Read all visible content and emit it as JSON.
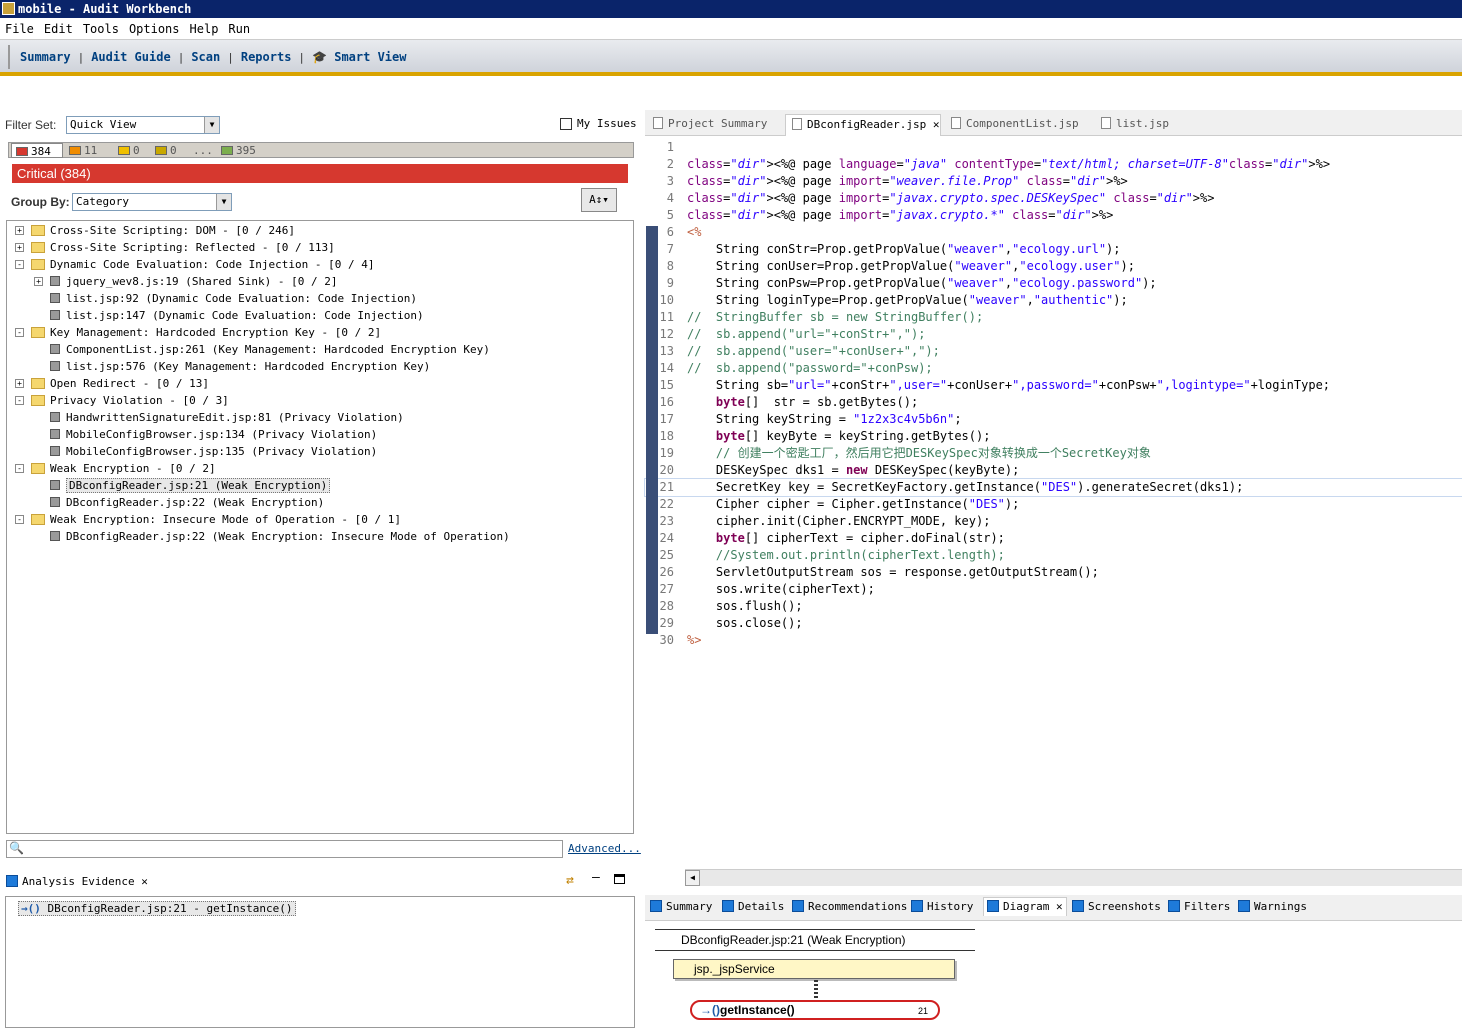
{
  "window": {
    "title": "mobile - Audit Workbench"
  },
  "menu": [
    "File",
    "Edit",
    "Tools",
    "Options",
    "Help",
    "Run"
  ],
  "nav": {
    "summary": "Summary",
    "audit_guide": "Audit Guide",
    "scan": "Scan",
    "reports": "Reports",
    "smart_view": "Smart View"
  },
  "filter": {
    "label": "Filter Set:",
    "value": "Quick View",
    "my_issues": "My Issues"
  },
  "severity_tabs": [
    {
      "count": "384",
      "color": "#d6382f"
    },
    {
      "count": "11",
      "color": "#f08c00"
    },
    {
      "count": "0",
      "color": "#f0c000"
    },
    {
      "count": "0",
      "color": "#c8a800"
    },
    {
      "count": "...",
      "color": ""
    },
    {
      "count": "395",
      "color": "#7cae4e"
    }
  ],
  "critical_label": "Critical (384)",
  "group_by": {
    "label": "Group By:",
    "value": "Category"
  },
  "tree": [
    {
      "text": "Cross-Site Scripting: DOM - [0 / 246]",
      "level": 0,
      "type": "folder",
      "exp": "+"
    },
    {
      "text": "Cross-Site Scripting: Reflected - [0 / 113]",
      "level": 0,
      "type": "folder",
      "exp": "+"
    },
    {
      "text": "Dynamic Code Evaluation: Code Injection - [0 / 4]",
      "level": 0,
      "type": "folder",
      "exp": "-"
    },
    {
      "text": "jquery_wev8.js:19 (Shared Sink) - [0 / 2]",
      "level": 1,
      "type": "issue",
      "exp": "+"
    },
    {
      "text": "list.jsp:92 (Dynamic Code Evaluation: Code Injection)",
      "level": 1,
      "type": "issue",
      "exp": ""
    },
    {
      "text": "list.jsp:147 (Dynamic Code Evaluation: Code Injection)",
      "level": 1,
      "type": "issue",
      "exp": ""
    },
    {
      "text": "Key Management: Hardcoded Encryption Key - [0 / 2]",
      "level": 0,
      "type": "folder",
      "exp": "-"
    },
    {
      "text": "ComponentList.jsp:261 (Key Management: Hardcoded Encryption Key)",
      "level": 1,
      "type": "issue",
      "exp": ""
    },
    {
      "text": "list.jsp:576 (Key Management: Hardcoded Encryption Key)",
      "level": 1,
      "type": "issue",
      "exp": ""
    },
    {
      "text": "Open Redirect - [0 / 13]",
      "level": 0,
      "type": "folder",
      "exp": "+"
    },
    {
      "text": "Privacy Violation - [0 / 3]",
      "level": 0,
      "type": "folder",
      "exp": "-"
    },
    {
      "text": "HandwrittenSignatureEdit.jsp:81 (Privacy Violation)",
      "level": 1,
      "type": "issue",
      "exp": ""
    },
    {
      "text": "MobileConfigBrowser.jsp:134 (Privacy Violation)",
      "level": 1,
      "type": "issue",
      "exp": ""
    },
    {
      "text": "MobileConfigBrowser.jsp:135 (Privacy Violation)",
      "level": 1,
      "type": "issue",
      "exp": ""
    },
    {
      "text": "Weak Encryption - [0 / 2]",
      "level": 0,
      "type": "folder",
      "exp": "-"
    },
    {
      "text": "DBconfigReader.jsp:21 (Weak Encryption)",
      "level": 1,
      "type": "issue",
      "exp": "",
      "selected": true
    },
    {
      "text": "DBconfigReader.jsp:22 (Weak Encryption)",
      "level": 1,
      "type": "issue",
      "exp": ""
    },
    {
      "text": "Weak Encryption: Insecure Mode of Operation - [0 / 1]",
      "level": 0,
      "type": "folder",
      "exp": "-"
    },
    {
      "text": "DBconfigReader.jsp:22 (Weak Encryption: Insecure Mode of Operation)",
      "level": 1,
      "type": "issue",
      "exp": ""
    }
  ],
  "search": {
    "advanced": "Advanced..."
  },
  "evidence": {
    "tab": "Analysis Evidence",
    "item": "DBconfigReader.jsp:21 - getInstance()"
  },
  "editor_tabs": [
    "Project Summary",
    "DBconfigReader.jsp",
    "ComponentList.jsp",
    "list.jsp"
  ],
  "code_lines": [
    {
      "n": "1",
      "t": ""
    },
    {
      "n": "2",
      "t": "<%@ page language=\"java\" contentType=\"text/html; charset=UTF-8\"%>"
    },
    {
      "n": "3",
      "t": "<%@ page import=\"weaver.file.Prop\" %>"
    },
    {
      "n": "4",
      "t": "<%@ page import=\"javax.crypto.spec.DESKeySpec\" %>"
    },
    {
      "n": "5",
      "t": "<%@ page import=\"javax.crypto.*\" %>"
    },
    {
      "n": "6",
      "t": "<%"
    },
    {
      "n": "7",
      "t": "    String conStr=Prop.getPropValue(\"weaver\",\"ecology.url\");"
    },
    {
      "n": "8",
      "t": "    String conUser=Prop.getPropValue(\"weaver\",\"ecology.user\");"
    },
    {
      "n": "9",
      "t": "    String conPsw=Prop.getPropValue(\"weaver\",\"ecology.password\");"
    },
    {
      "n": "10",
      "t": "    String loginType=Prop.getPropValue(\"weaver\",\"authentic\");"
    },
    {
      "n": "11",
      "t": "//  StringBuffer sb = new StringBuffer();"
    },
    {
      "n": "12",
      "t": "//  sb.append(\"url=\"+conStr+\",\");"
    },
    {
      "n": "13",
      "t": "//  sb.append(\"user=\"+conUser+\",\");"
    },
    {
      "n": "14",
      "t": "//  sb.append(\"password=\"+conPsw);"
    },
    {
      "n": "15",
      "t": "    String sb=\"url=\"+conStr+\",user=\"+conUser+\",password=\"+conPsw+\",logintype=\"+loginType;"
    },
    {
      "n": "16",
      "t": "    byte[]  str = sb.getBytes();"
    },
    {
      "n": "17",
      "t": "    String keyString = \"1z2x3c4v5b6n\";"
    },
    {
      "n": "18",
      "t": "    byte[] keyByte = keyString.getBytes();"
    },
    {
      "n": "19",
      "t": "    // 创建一个密匙工厂，然后用它把DESKeySpec对象转换成一个SecretKey对象"
    },
    {
      "n": "20",
      "t": "    DESKeySpec dks1 = new DESKeySpec(keyByte);"
    },
    {
      "n": "21",
      "t": "    SecretKey key = SecretKeyFactory.getInstance(\"DES\").generateSecret(dks1);"
    },
    {
      "n": "22",
      "t": "    Cipher cipher = Cipher.getInstance(\"DES\");"
    },
    {
      "n": "23",
      "t": "    cipher.init(Cipher.ENCRYPT_MODE, key);"
    },
    {
      "n": "24",
      "t": "    byte[] cipherText = cipher.doFinal(str);"
    },
    {
      "n": "25",
      "t": "    //System.out.println(cipherText.length);"
    },
    {
      "n": "26",
      "t": "    ServletOutputStream sos = response.getOutputStream();"
    },
    {
      "n": "27",
      "t": "    sos.write(cipherText);"
    },
    {
      "n": "28",
      "t": "    sos.flush();"
    },
    {
      "n": "29",
      "t": "    sos.close();"
    },
    {
      "n": "30",
      "t": "%>"
    }
  ],
  "bottom_tabs": [
    "Summary",
    "Details",
    "Recommendations",
    "History",
    "Diagram",
    "Screenshots",
    "Filters",
    "Warnings"
  ],
  "diagram": {
    "header": "DBconfigReader.jsp:21 (Weak Encryption)",
    "service": "jsp._jspService",
    "call": "getInstance()",
    "line": "21"
  }
}
